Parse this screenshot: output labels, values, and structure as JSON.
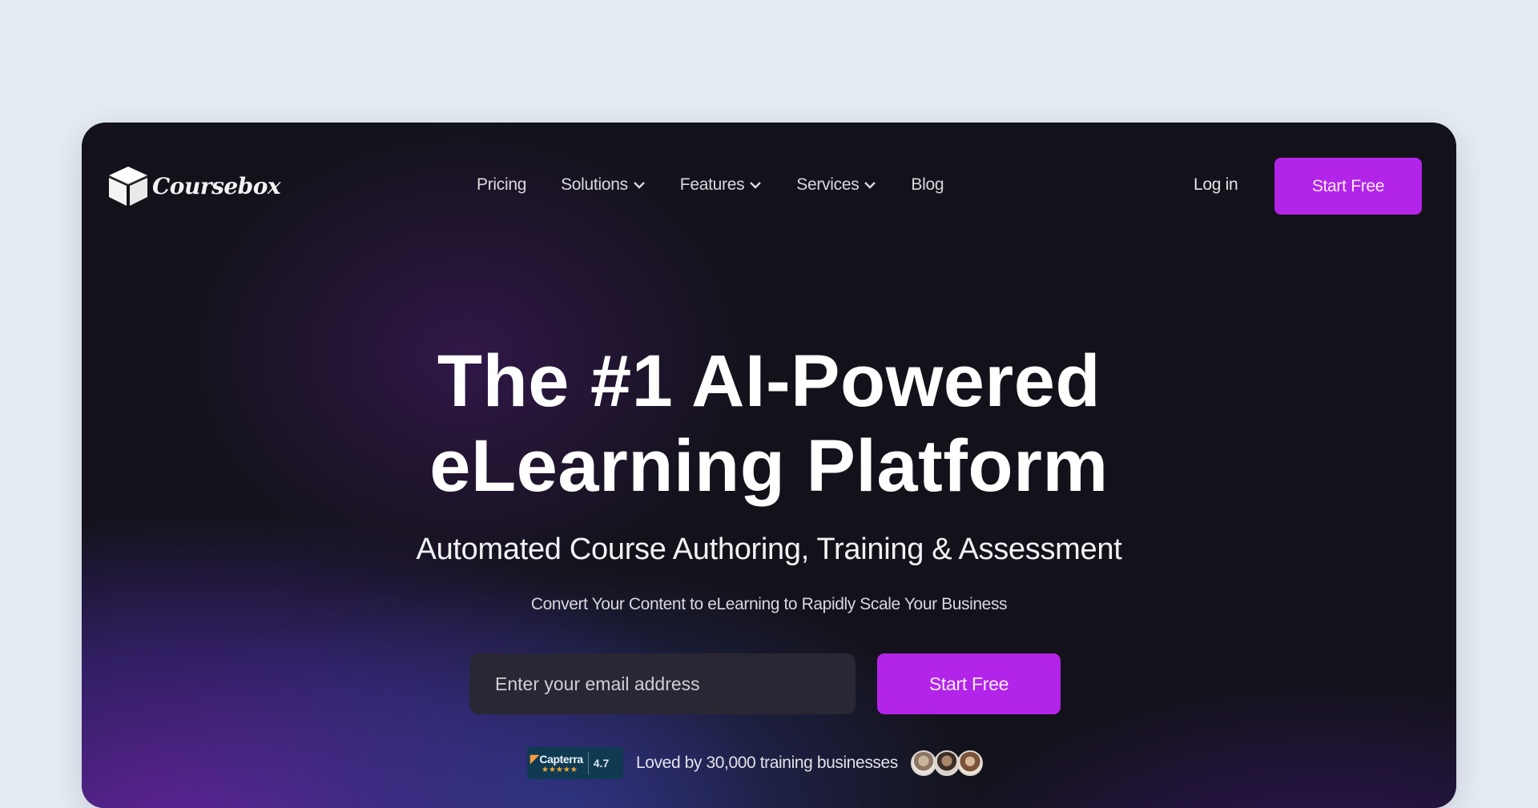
{
  "brand": {
    "name": "Coursebox",
    "logo_icon": "cube-icon"
  },
  "nav": {
    "links": [
      {
        "label": "Pricing",
        "has_dropdown": false
      },
      {
        "label": "Solutions",
        "has_dropdown": true
      },
      {
        "label": "Features",
        "has_dropdown": true
      },
      {
        "label": "Services",
        "has_dropdown": true
      },
      {
        "label": "Blog",
        "has_dropdown": false
      }
    ],
    "login_label": "Log in",
    "cta_label": "Start Free"
  },
  "hero": {
    "title_line1": "The #1 AI-Powered",
    "title_line2": "eLearning Platform",
    "subtitle": "Automated Course Authoring, Training & Assessment",
    "description": "Convert Your Content to eLearning to Rapidly Scale Your Business",
    "email_placeholder": "Enter your email address",
    "email_value": "",
    "cta_label": "Start Free"
  },
  "social_proof": {
    "badge_name": "Capterra",
    "badge_stars": "★★★★★",
    "badge_rating": "4.7",
    "text": "Loved by 30,000 training businesses",
    "avatar_count": 3
  },
  "colors": {
    "accent": "#b224e8",
    "card_bg": "#13121a",
    "page_bg": "#e6ecf3",
    "input_bg": "#2a2734"
  }
}
